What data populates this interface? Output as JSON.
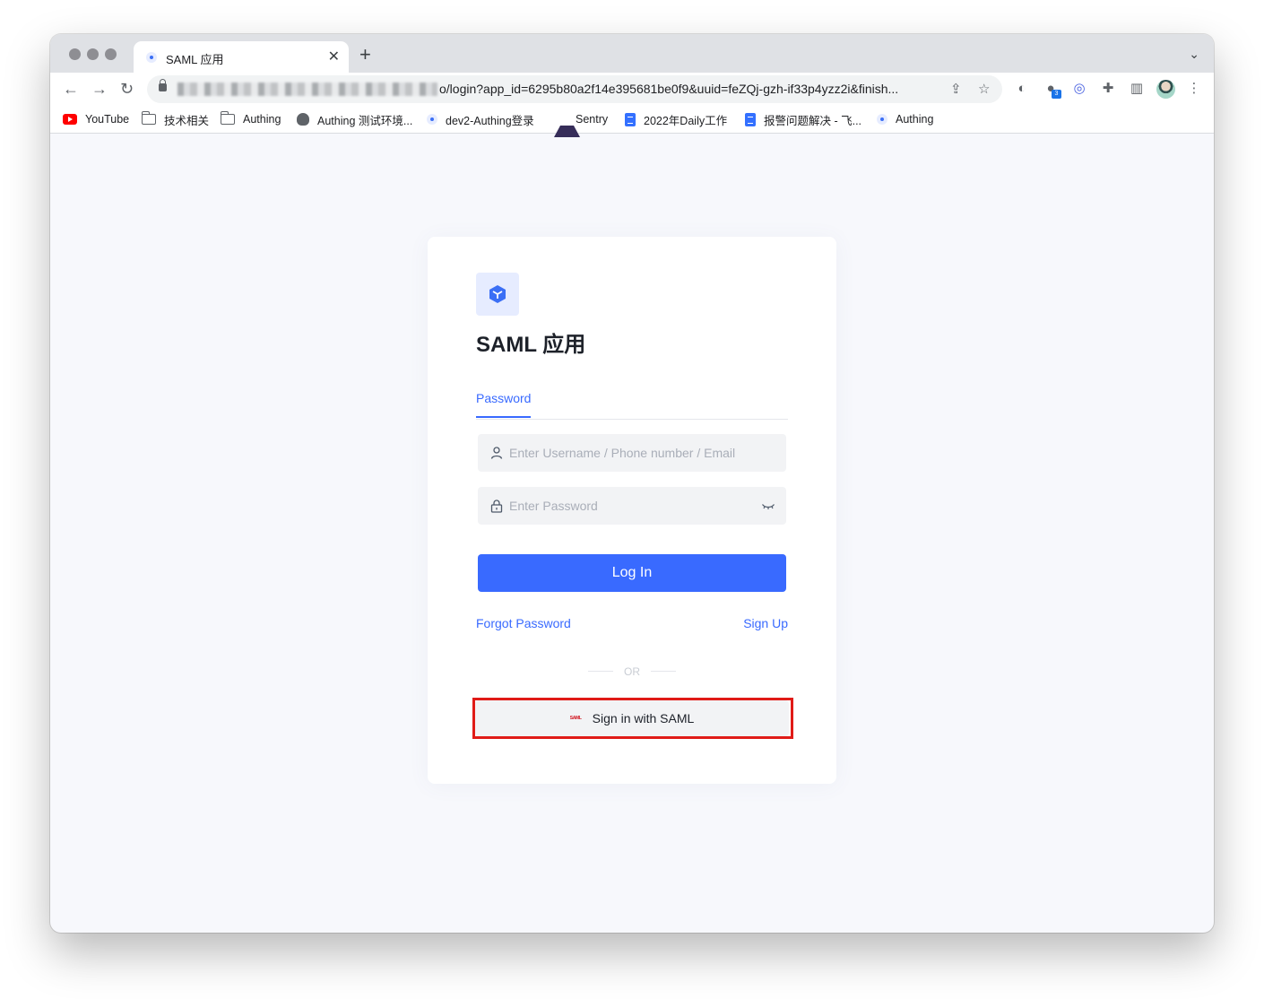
{
  "browser": {
    "tab": {
      "title": "SAML 应用"
    },
    "new_tab": "+",
    "tab_close": "✕",
    "url_path": "o/login?app_id=6295b80a2f14e395681be0f9&uuid=feZQj-gzh-if33p4yzz2i&finish...",
    "extension_badge": "3",
    "bookmarks": [
      {
        "label": "YouTube",
        "icon": "youtube-icon"
      },
      {
        "label": "技术相关",
        "icon": "folder-icon"
      },
      {
        "label": "Authing",
        "icon": "folder-icon"
      },
      {
        "label": "Authing 测试环境...",
        "icon": "robot-icon"
      },
      {
        "label": "dev2-Authing登录",
        "icon": "authing-icon"
      },
      {
        "label": "Sentry",
        "icon": "sentry-icon"
      },
      {
        "label": "2022年Daily工作",
        "icon": "doc-icon"
      },
      {
        "label": "报警问题解决 - 飞...",
        "icon": "doc-icon"
      },
      {
        "label": "Authing",
        "icon": "authing-icon"
      }
    ]
  },
  "login": {
    "app_title": "SAML 应用",
    "tab_password": "Password",
    "username_placeholder": "Enter Username / Phone number / Email",
    "password_placeholder": "Enter Password",
    "login_button": "Log In",
    "forgot_password": "Forgot Password",
    "sign_up": "Sign Up",
    "divider_text": "OR",
    "saml_logo_text": "SAML",
    "saml_button": "Sign in with SAML"
  },
  "colors": {
    "primary": "#396aff",
    "highlight": "#e01b17",
    "page_background": "#f7f8fc"
  }
}
